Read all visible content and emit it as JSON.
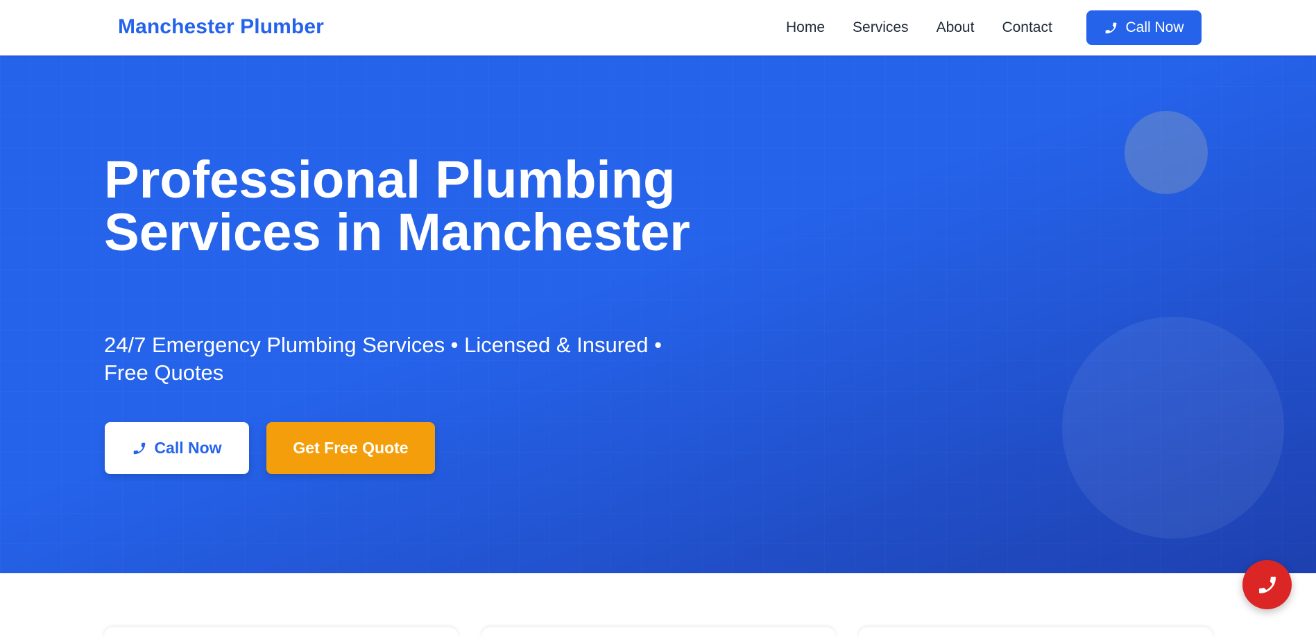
{
  "header": {
    "brand": "Manchester Plumber",
    "nav": [
      {
        "label": "Home"
      },
      {
        "label": "Services"
      },
      {
        "label": "About"
      },
      {
        "label": "Contact"
      }
    ],
    "cta_label": "Call Now",
    "cta_icon": "phone-icon"
  },
  "hero": {
    "title": "Professional Plumbing Services in Manchester",
    "subtitle": "24/7 Emergency Plumbing Services • Licensed & Insured • Free Quotes",
    "primary_button": {
      "label": "Call Now",
      "icon": "phone-icon"
    },
    "secondary_button": {
      "label": "Get Free Quote"
    }
  },
  "floating_action": {
    "icon": "phone-icon"
  },
  "colors": {
    "primary": "#2563eb",
    "primary_dark": "#1e40af",
    "accent": "#f59e0b",
    "emergency": "#dc2626",
    "nav_text": "#1f2937",
    "white": "#ffffff"
  }
}
